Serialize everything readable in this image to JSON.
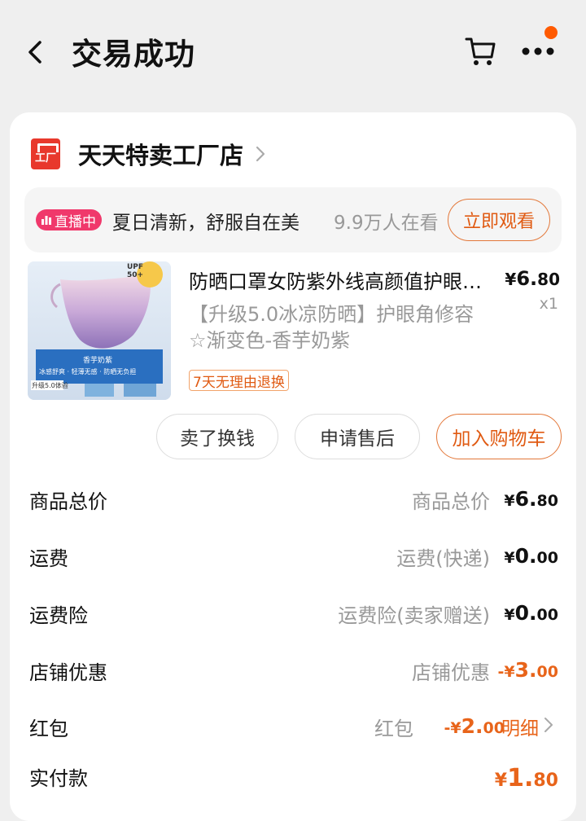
{
  "header": {
    "title": "交易成功",
    "icons": [
      "back-icon",
      "cart-icon",
      "more-icon"
    ]
  },
  "shop": {
    "name": "天天特卖工厂店",
    "logo_text": "工厂",
    "brand_color": "#e8382c"
  },
  "live": {
    "badge": "直播中",
    "text": "夏日清新，舒服自在美",
    "viewers": "9.9万人在看",
    "watch_button": "立即观看"
  },
  "product": {
    "image_labels": {
      "upf": "UPF 50+",
      "color_name": "香芋奶紫",
      "features": "冰感舒爽 · 轻薄无感 · 防晒无负担",
      "version_tag": "升级5.0体验"
    },
    "title": "防晒口罩女防紫外线高颜值护眼角修容",
    "price_symbol": "¥",
    "price_int": "6.",
    "price_dec": "80",
    "quantity": "x1",
    "spec": "【升级5.0冰凉防晒】护眼角修容☆渐变色-香芋奶紫",
    "return_tag": "7天无理由退换"
  },
  "actions": {
    "sell": "卖了换钱",
    "after_sale": "申请售后",
    "add_cart": "加入购物车"
  },
  "summary": {
    "total": {
      "label": "商品总价",
      "sub": "商品总价",
      "symbol": "¥",
      "int": "6.",
      "dec": "80"
    },
    "shipping": {
      "label": "运费",
      "sub": "运费(快递)",
      "symbol": "¥",
      "int": "0.",
      "dec": "00"
    },
    "shipping_insurance": {
      "label": "运费险",
      "sub": "运费险(卖家赠送)",
      "symbol": "¥",
      "int": "0.",
      "dec": "00"
    },
    "shop_discount": {
      "label": "店铺优惠",
      "sub": "店铺优惠",
      "symbol": "-¥",
      "int": "3.",
      "dec": "00"
    },
    "hongbao": {
      "label": "红包",
      "sub": "红包",
      "symbol": "-¥",
      "int": "2.",
      "dec": "00",
      "detail": "明细"
    },
    "paid": {
      "label": "实付款",
      "symbol": "¥",
      "int": "1.",
      "dec": "80"
    }
  },
  "colors": {
    "accent": "#e8641a",
    "live_badge": "#f0386b",
    "notify_dot": "#ff5a00"
  }
}
